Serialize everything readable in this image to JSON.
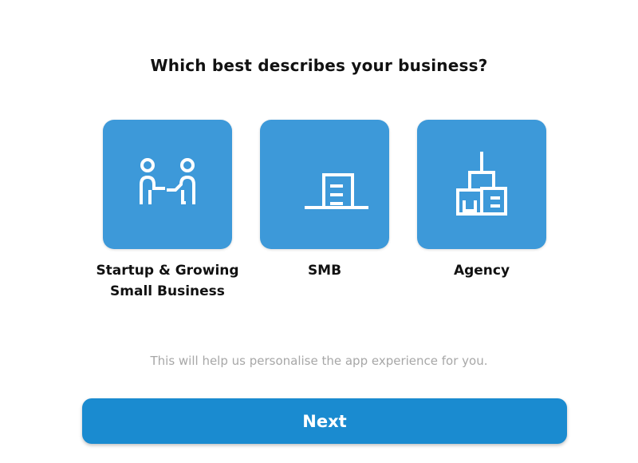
{
  "title": "Which best describes your business?",
  "options": [
    {
      "label": "Startup & Growing Small Business",
      "icon": "people-handshake-icon"
    },
    {
      "label": "SMB",
      "icon": "office-building-icon"
    },
    {
      "label": "Agency",
      "icon": "building-network-icon"
    }
  ],
  "helper_text": "This will help us personalise the app experience for you.",
  "next_label": "Next",
  "colors": {
    "tile": "#3d99d9",
    "button": "#1a8bd0",
    "icon_stroke": "#ffffff"
  }
}
